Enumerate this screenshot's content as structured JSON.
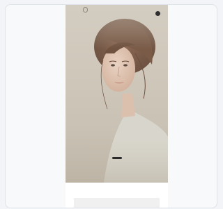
{
  "brand": {
    "name": "",
    "tagline": ""
  },
  "hero": {
    "title": "",
    "subtitle": "",
    "cta_label": ""
  },
  "info_section": {
    "title": "",
    "line": ""
  },
  "colors": {
    "background": "#f3f4f7",
    "hero_tone": "#cfc7ba",
    "cta_background": "#2a2a2a"
  }
}
